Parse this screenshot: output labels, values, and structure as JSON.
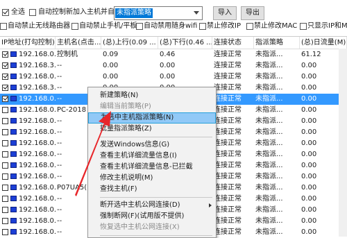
{
  "toolbar": {
    "select_all": "全选",
    "auto_add": "自动控制新加入主机并自动",
    "policy_value": "未指派策略",
    "import": "导入",
    "export": "导出",
    "opt_wireless": "自动禁止无线路由器",
    "opt_phone": "自动禁止手机/平板",
    "opt_wifi": "自动禁用随身wifi",
    "opt_ip": "禁止修改IP",
    "opt_mac": "禁止修改MAC",
    "opt_show": "只显示IP和M"
  },
  "table": {
    "columns": [
      "IP地址(打勾控制)",
      "主机名(点击...",
      "(总)上行(0.09 ...",
      "(总)下行(0.46 ...",
      "连接状态",
      "指派策略",
      "(总)日流量(M)"
    ],
    "rows": [
      {
        "checked": true,
        "ip": "192.168.0....",
        "host": "控制机",
        "up": "0.09",
        "down": "0.46",
        "status": "连接正常",
        "policy": "未指派...",
        "daily": "61.12"
      },
      {
        "checked": true,
        "ip": "192.168.3....",
        "host": "--",
        "up": "0.00",
        "down": "0.00",
        "status": "连接正常",
        "policy": "未指派...",
        "daily": "0.00"
      },
      {
        "checked": true,
        "ip": "192.168.0....",
        "host": "--",
        "up": "0.00",
        "down": "0.00",
        "status": "连接正常",
        "policy": "未指派...",
        "daily": "0.00"
      },
      {
        "checked": true,
        "ip": "192.168.3....",
        "host": "--",
        "up": "0.00",
        "down": "0.00",
        "status": "连接正常",
        "policy": "未指派...",
        "daily": "0.00"
      },
      {
        "checked": true,
        "ip": "192.168.0....",
        "host": "--",
        "up": "",
        "down": "",
        "status": "连接正常",
        "policy": "未指派...",
        "daily": "0.00"
      },
      {
        "checked": false,
        "ip": "192.168.0....",
        "host": "PC-2018",
        "up": "",
        "down": "",
        "status": "连接正常",
        "policy": "未指派...",
        "daily": "0.00"
      },
      {
        "checked": false,
        "ip": "192.168.0....",
        "host": "--",
        "up": "",
        "down": "",
        "status": "连接正常",
        "policy": "未指派...",
        "daily": "0.00"
      },
      {
        "checked": false,
        "ip": "192.168.0....",
        "host": "--",
        "up": "",
        "down": "",
        "status": "连接正常",
        "policy": "未指派...",
        "daily": "0.00"
      },
      {
        "checked": false,
        "ip": "192.168.0....",
        "host": "--",
        "up": "",
        "down": "",
        "status": "连接正常",
        "policy": "未指派...",
        "daily": "0.00"
      },
      {
        "checked": false,
        "ip": "192.168.0....",
        "host": "--",
        "up": "",
        "down": "",
        "status": "连接正常",
        "policy": "未指派...",
        "daily": "0.00"
      },
      {
        "checked": false,
        "ip": "192.168.0....",
        "host": "--",
        "up": "",
        "down": "",
        "status": "连接正常",
        "policy": "未指派...",
        "daily": "0.00"
      },
      {
        "checked": false,
        "ip": "192.168.0....",
        "host": "--",
        "up": "",
        "down": "",
        "status": "连接正常",
        "policy": "未指派...",
        "daily": "0.00"
      },
      {
        "checked": false,
        "ip": "192.168.0....",
        "host": "P07UA5(",
        "up": "",
        "down": "",
        "status": "连接正常",
        "policy": "未指派...",
        "daily": "0.00"
      },
      {
        "checked": false,
        "ip": "192.168.0....",
        "host": "--",
        "up": "",
        "down": "",
        "status": "连接正常",
        "policy": "未指派...",
        "daily": "0.00"
      },
      {
        "checked": false,
        "ip": "192.168.0....",
        "host": "--",
        "up": "",
        "down": "",
        "status": "连接正常",
        "policy": "未指派...",
        "daily": "0.00"
      },
      {
        "checked": false,
        "ip": "192.168.0....",
        "host": "--",
        "up": "",
        "down": "",
        "status": "连接正常",
        "policy": "未指派...",
        "daily": "0.00"
      },
      {
        "checked": false,
        "ip": "192.168.0....",
        "host": "--",
        "up": "",
        "down": "",
        "status": "连接正常",
        "policy": "未指派...",
        "daily": "0.00"
      }
    ]
  },
  "context_menu": [
    {
      "label": "新建策略(N)",
      "disabled": false
    },
    {
      "label": "编辑当前策略(P)",
      "disabled": true
    },
    {
      "label": "为选中主机指派策略(N)",
      "disabled": false,
      "highlighted": true
    },
    {
      "label": "批量指派策略(Z)",
      "disabled": false
    },
    {
      "sep": true
    },
    {
      "label": "发送Windows信息(G)",
      "disabled": false
    },
    {
      "label": "查看主机详细流量信息(I)",
      "disabled": false
    },
    {
      "label": "查看主机详细流量信息-已拦截",
      "disabled": false
    },
    {
      "label": "修改主机说明(M)",
      "disabled": false
    },
    {
      "label": "查找主机(F)",
      "disabled": false
    },
    {
      "sep": true
    },
    {
      "label": "断开选中主机公网连接(D)",
      "disabled": false,
      "submenu": true
    },
    {
      "label": "强制断网(F)(试用版不提供)",
      "disabled": false
    },
    {
      "label": "恢复选中主机公网连接(X)",
      "disabled": true
    },
    {
      "sep": true
    },
    {
      "label": "断开所有主机公网连接(A)",
      "disabled": true
    }
  ],
  "colors": {
    "selection": "#3399ff",
    "highlight": "#91c9f7",
    "arrow": "#e8262a"
  },
  "icons": {
    "row_icon": "computer-icon",
    "pointer": "red-arrow-annotation"
  }
}
